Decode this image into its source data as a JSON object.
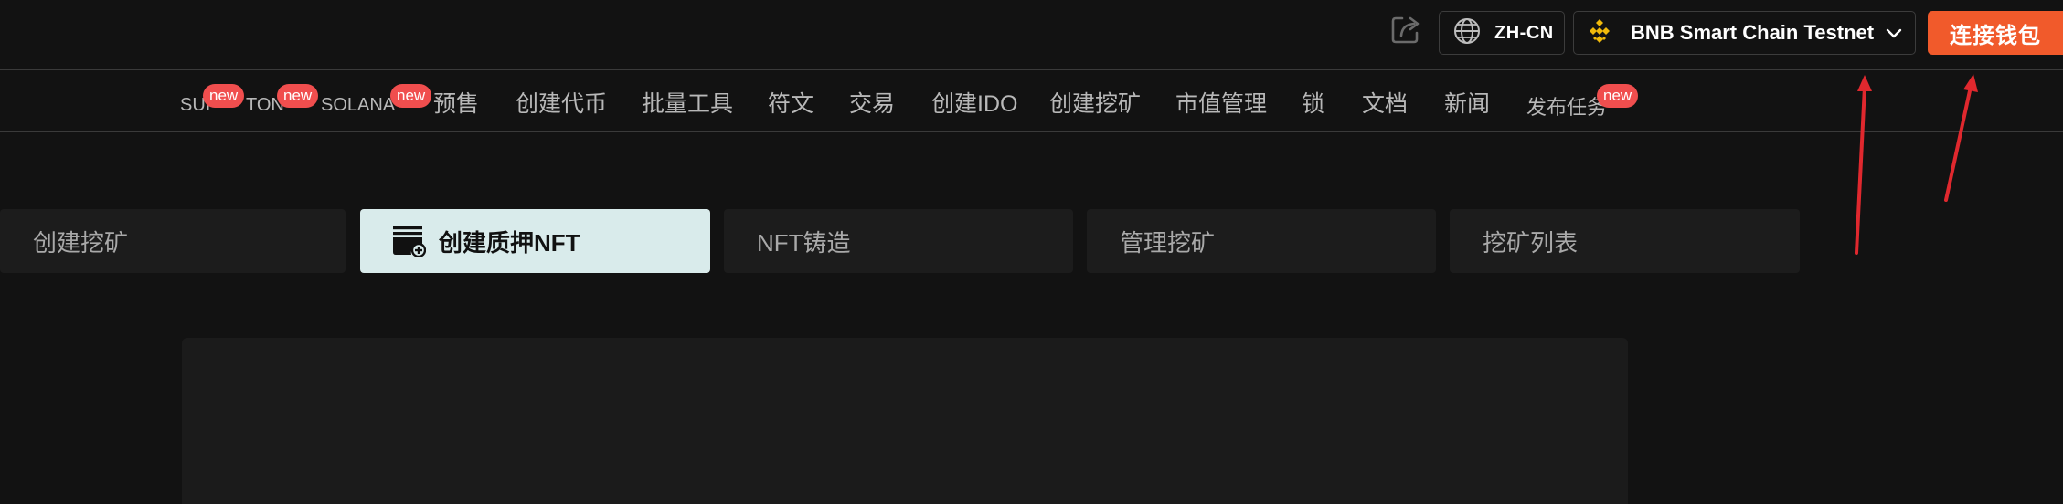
{
  "header": {
    "language_label": "ZH-CN",
    "chain_label": "BNB Smart Chain Testnet",
    "connect_label": "连接钱包",
    "colors": {
      "connect": "#f15a2b",
      "bnb": "#f0b90b"
    }
  },
  "nav": {
    "badge_text": "new",
    "items": [
      {
        "label": "SUI",
        "badge": true
      },
      {
        "label": "TON",
        "badge": true
      },
      {
        "label": "SOLANA",
        "badge": true
      },
      {
        "label": "预售"
      },
      {
        "label": "创建代币"
      },
      {
        "label": "批量工具"
      },
      {
        "label": "符文"
      },
      {
        "label": "交易"
      },
      {
        "label": "创建IDO"
      },
      {
        "label": "创建挖矿"
      },
      {
        "label": "市值管理"
      },
      {
        "label": "锁"
      },
      {
        "label": "文档"
      },
      {
        "label": "新闻"
      },
      {
        "label": "发布任务",
        "badge": true
      }
    ]
  },
  "tabs": [
    {
      "label": "创建挖矿",
      "active": false
    },
    {
      "label": "创建质押NFT",
      "active": true,
      "icon": "stack-add-icon"
    },
    {
      "label": "NFT铸造",
      "active": false
    },
    {
      "label": "管理挖矿",
      "active": false
    },
    {
      "label": "挖矿列表",
      "active": false
    }
  ],
  "icons": {
    "share": "share-icon",
    "globe": "globe-icon",
    "bnb": "bnb-logo-icon",
    "chevron": "chevron-down-icon"
  }
}
